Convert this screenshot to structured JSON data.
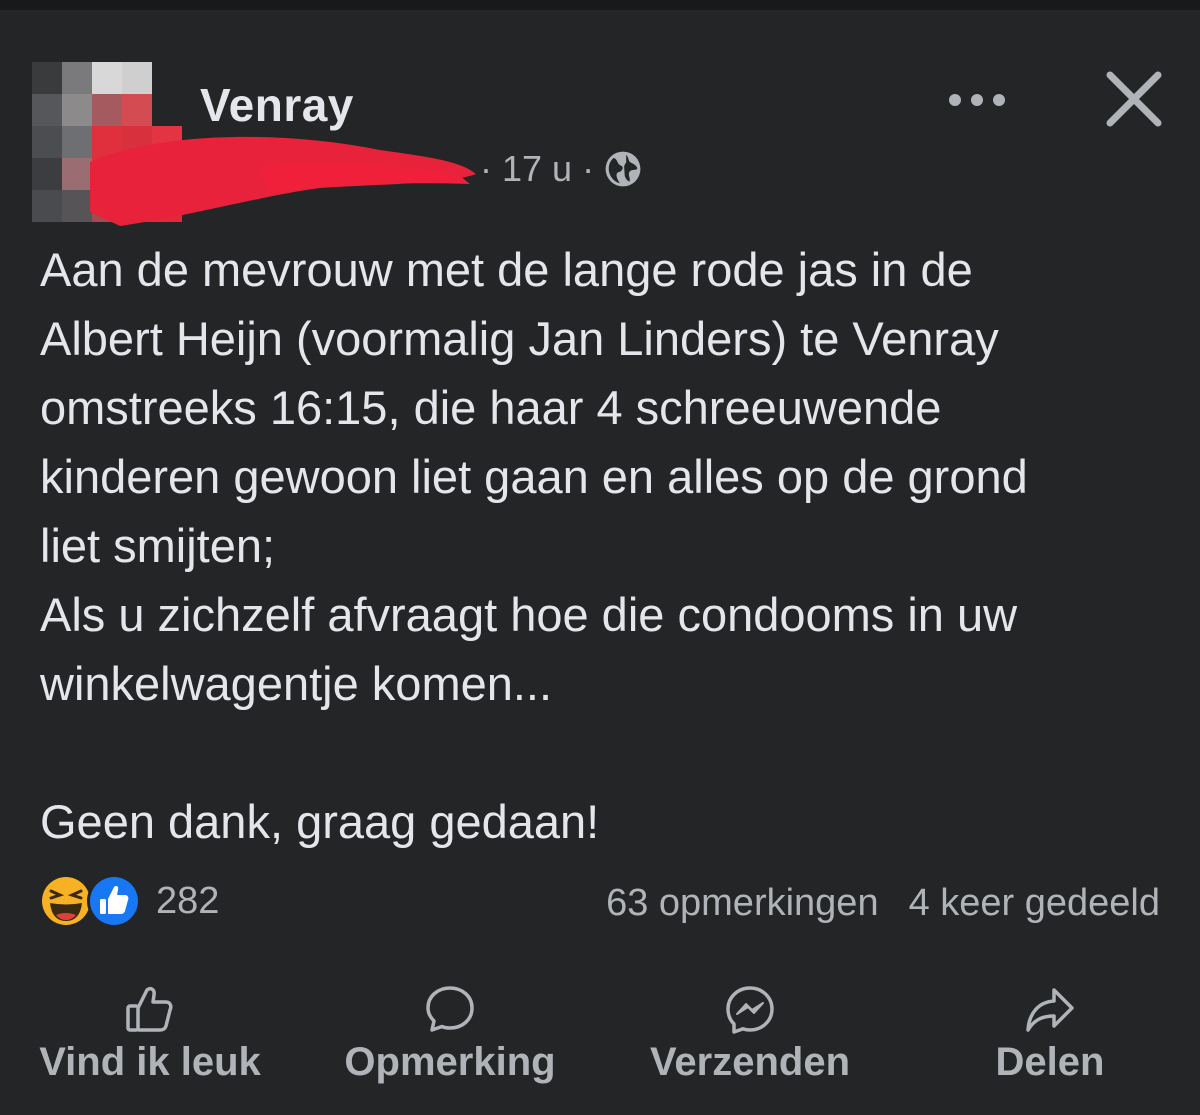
{
  "post": {
    "page_name": "Venray",
    "time": "17 u",
    "separator": "·",
    "text": [
      "Aan de mevrouw met de lange rode jas in de",
      "Albert Heijn (voormalig Jan Linders) te Venray",
      "omstreeks 16:15, die haar 4 schreeuwende",
      "kinderen gewoon liet gaan en alles op de grond",
      "liet smijten;",
      "Als u zichzelf afvraagt hoe die condooms in uw",
      "winkelwagentje komen..."
    ],
    "closing": "Geen dank, graag gedaan!"
  },
  "reactions": {
    "count": "282",
    "icons": [
      "haha-icon",
      "like-icon"
    ]
  },
  "stats": {
    "comments": "63 opmerkingen",
    "shares": "4 keer gedeeld"
  },
  "actions": {
    "like": "Vind ik leuk",
    "comment": "Opmerking",
    "send": "Verzenden",
    "share": "Delen"
  },
  "colors": {
    "background": "#242526",
    "text": "#e4e6eb",
    "secondary": "#b0b3b8",
    "like_blue": "#1877f2",
    "haha_yellow": "#f7b125",
    "redaction_red": "#e8223a"
  }
}
